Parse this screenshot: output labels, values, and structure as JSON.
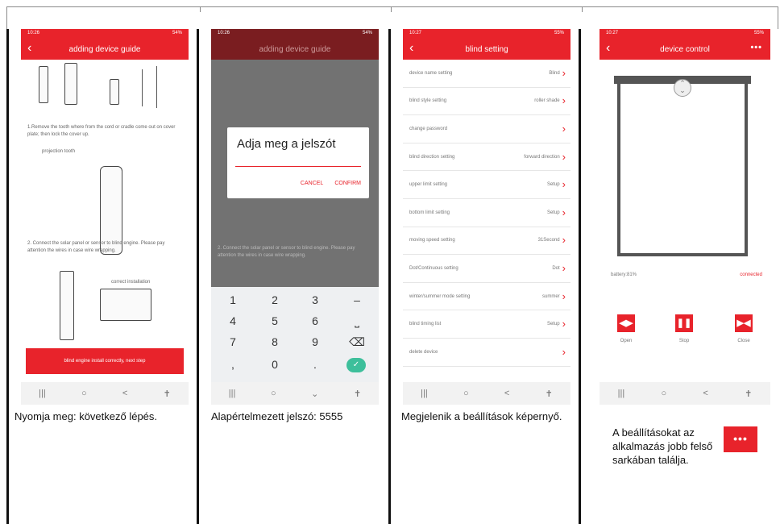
{
  "phone1": {
    "status_time": "10:26",
    "status_right": "54%",
    "title": "adding device guide",
    "step_text": "1.Remove the tooth where from the cord or cradle come out on cover plate; then lock the cover up.",
    "label_tooth": "projection tooth",
    "step2_text": "2. Connect the solar panel or sensor to blind engine. Please pay attention the wires in case wire wrapping.",
    "label_install": "correct installation",
    "next_button": "blind engine install correctly, next step"
  },
  "phone2": {
    "status_time": "10:26",
    "status_right": "54%",
    "title": "adding device guide",
    "dialog_title": "Adja meg a jelszót",
    "cancel": "CANCEL",
    "confirm": "CONFIRM",
    "bg_text": "2. Connect the solar panel or sensor to blind engine. Please pay attention the wires in case wire wrapping.",
    "keys": [
      "1",
      "2",
      "3",
      "–",
      "4",
      "5",
      "6",
      "⎵",
      "7",
      "8",
      "9",
      "⌫",
      ",",
      "0",
      "."
    ],
    "ok": "✓"
  },
  "phone3": {
    "status_time": "10:27",
    "status_right": "55%",
    "title": "blind setting",
    "rows": [
      {
        "label": "device name setting",
        "value": "Blind"
      },
      {
        "label": "blind style setting",
        "value": "roller shade"
      },
      {
        "label": "change password",
        "value": ""
      },
      {
        "label": "blind direction setting",
        "value": "forward direction"
      },
      {
        "label": "upper limit setting",
        "value": "Setup"
      },
      {
        "label": "bottom limit setting",
        "value": "Setup"
      },
      {
        "label": "moving speed setting",
        "value": "31Second"
      },
      {
        "label": "Dot/Continuous setting",
        "value": "Dot"
      },
      {
        "label": "winter/summer mode setting",
        "value": "summer"
      },
      {
        "label": "blind timing list",
        "value": "Setup"
      },
      {
        "label": "delete device",
        "value": ""
      }
    ]
  },
  "phone4": {
    "status_time": "10:27",
    "status_right": "55%",
    "title": "device control",
    "more": "•••",
    "battery": "battery:81%",
    "connected": "connected",
    "open": "Open",
    "stop": "Stop",
    "close": "Close",
    "open_icon": "◀▶",
    "stop_icon": "❚❚",
    "close_icon": "▶◀"
  },
  "nav": {
    "recent": "|||",
    "home": "○",
    "back": "<",
    "extra": "✝"
  },
  "captions": {
    "c1": "Nyomja meg: következő lépés.",
    "c2": "Alapértelmezett jelszó: 5555",
    "c3": "Megjelenik a beállítások képernyő.",
    "c4": "A beállításokat az alkalmazás jobb felső sarkában találja."
  },
  "more_button": "•••",
  "colors": {
    "accent": "#e8232b",
    "ok": "#3dbf9b"
  }
}
